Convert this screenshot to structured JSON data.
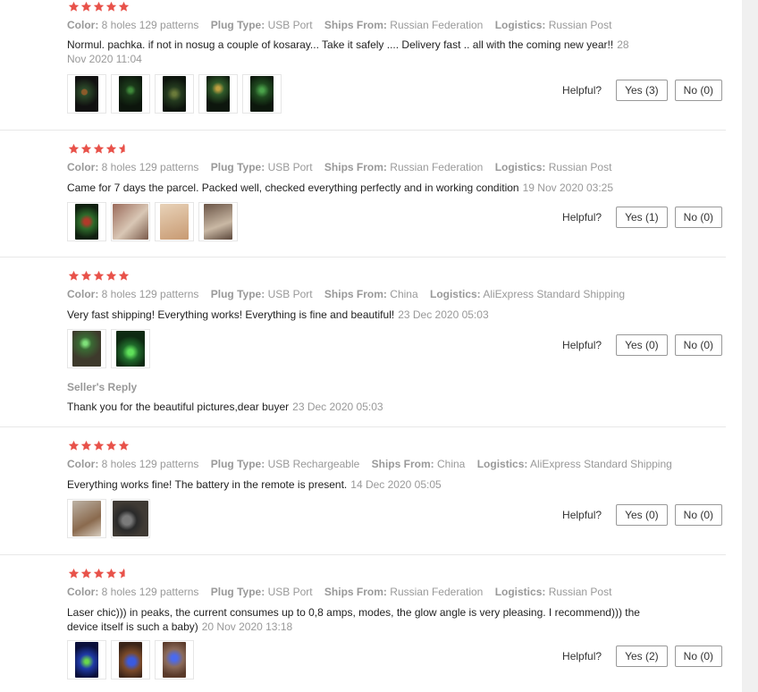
{
  "labels": {
    "color": "Color:",
    "plug_type": "Plug Type:",
    "ships_from": "Ships From:",
    "logistics": "Logistics:",
    "helpful": "Helpful?",
    "seller_reply": "Seller's Reply"
  },
  "colors": {
    "star": "#e8524a",
    "muted": "#999999"
  },
  "reviews": [
    {
      "rating": 5,
      "color": "8 holes 129 patterns",
      "plug_type": "USB Port",
      "ships_from": "Russian Federation",
      "logistics": "Russian Post",
      "text": "Normul. pachka. if not in nosug a couple of kosaray... Take it safely .... Delivery fast .. all with the coming new year!!",
      "date": "28 Nov 2020 11:04",
      "helpful_yes": "Yes (3)",
      "helpful_no": "No (0)",
      "thumbs": [
        "laser-photo",
        "laser-photo",
        "laser-photo",
        "laser-photo",
        "laser-photo"
      ]
    },
    {
      "rating": 4.5,
      "color": "8 holes 129 patterns",
      "plug_type": "USB Port",
      "ships_from": "Russian Federation",
      "logistics": "Russian Post",
      "text": "Came for 7 days the parcel. Packed well, checked everything perfectly and in working condition",
      "date": "19 Nov 2020 03:25",
      "helpful_yes": "Yes (1)",
      "helpful_no": "No (0)",
      "thumbs": [
        "laser-photo",
        "device-photo",
        "package-photo",
        "box-photo"
      ]
    },
    {
      "rating": 5,
      "color": "8 holes 129 patterns",
      "plug_type": "USB Port",
      "ships_from": "China",
      "logistics": "AliExpress Standard Shipping",
      "text": "Very fast shipping! Everything works! Everything is fine and beautiful!",
      "date": "23 Dec 2020 05:03",
      "helpful_yes": "Yes (0)",
      "helpful_no": "No (0)",
      "thumbs": [
        "green-light-photo",
        "green-light-photo"
      ],
      "seller_reply": {
        "text": "Thank you for the beautiful pictures,dear buyer",
        "date": "23 Dec 2020 05:03"
      }
    },
    {
      "rating": 5,
      "color": "8 holes 129 patterns",
      "plug_type": "USB Rechargeable",
      "ships_from": "China",
      "logistics": "AliExpress Standard Shipping",
      "text": "Everything works fine! The battery in the remote is present.",
      "date": "14 Dec 2020 05:05",
      "helpful_yes": "Yes (0)",
      "helpful_no": "No (0)",
      "thumbs": [
        "package-photo",
        "device-photo"
      ]
    },
    {
      "rating": 4.5,
      "color": "8 holes 129 patterns",
      "plug_type": "USB Port",
      "ships_from": "Russian Federation",
      "logistics": "Russian Post",
      "text": "Laser chic))) in peaks, the current consumes up to 0,8 amps, modes, the glow angle is very pleasing. I recommend))) the device itself is such a baby)",
      "date": "20 Nov 2020 13:18",
      "helpful_yes": "Yes (2)",
      "helpful_no": "No (0)",
      "thumbs": [
        "blue-light-photo",
        "blue-device-photo",
        "blue-device-photo"
      ]
    }
  ]
}
